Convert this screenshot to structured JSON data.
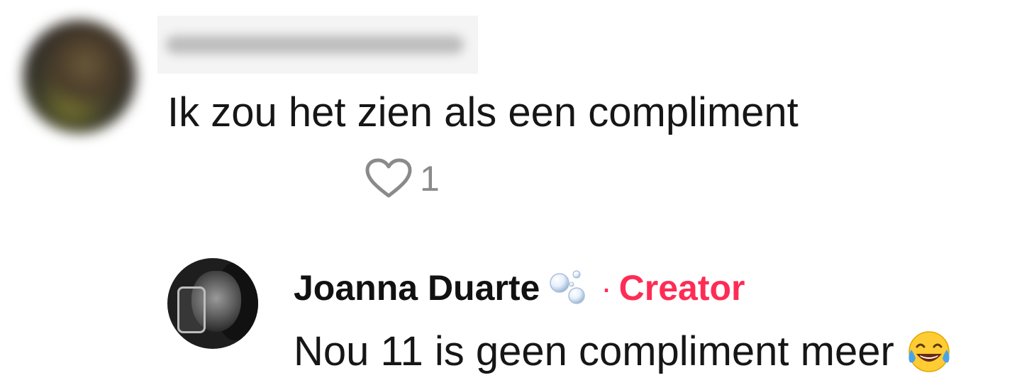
{
  "comment": {
    "text": "Ik zou het zien als een compliment",
    "like_count": "1",
    "icons": {
      "like": "heart-outline-icon"
    }
  },
  "reply": {
    "author": "Joanna Duarte",
    "separator": "·",
    "badge": "Creator",
    "text": "Nou 11 is geen compliment meer",
    "icons": {
      "name_decoration": "bubbles-icon",
      "emoji": "tears-of-joy-emoji"
    }
  },
  "colors": {
    "creator_accent": "#fe2c55",
    "like_gray": "#8a8a8a",
    "text": "#161616"
  }
}
